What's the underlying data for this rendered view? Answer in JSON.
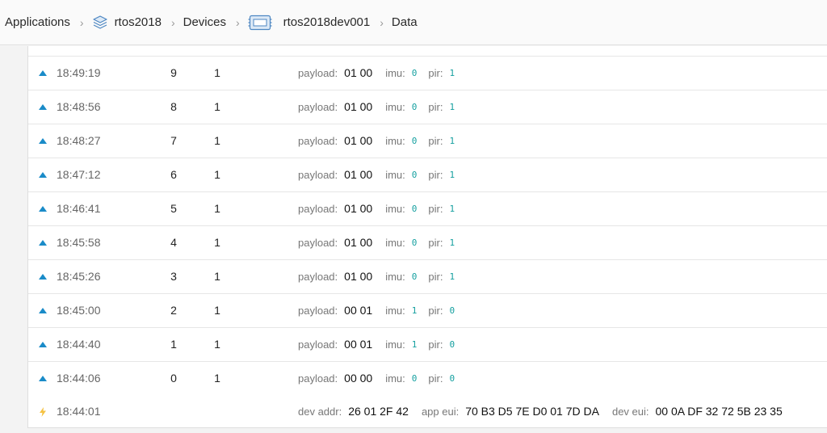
{
  "breadcrumb": {
    "applications": "Applications",
    "app_name": "rtos2018",
    "devices": "Devices",
    "device_name": "rtos2018dev001",
    "data": "Data"
  },
  "colors": {
    "uplink_arrow": "#1a8bc8",
    "activation_bolt": "#f5c242",
    "decoded_value": "#16a0a0"
  },
  "messages": [
    {
      "type": "uplink",
      "time": "18:49:19",
      "counter": "9",
      "port": "1",
      "payload_label": "payload:",
      "payload": "01 00",
      "imu_label": "imu:",
      "imu": "0",
      "pir_label": "pir:",
      "pir": "1"
    },
    {
      "type": "uplink",
      "time": "18:48:56",
      "counter": "8",
      "port": "1",
      "payload_label": "payload:",
      "payload": "01 00",
      "imu_label": "imu:",
      "imu": "0",
      "pir_label": "pir:",
      "pir": "1"
    },
    {
      "type": "uplink",
      "time": "18:48:27",
      "counter": "7",
      "port": "1",
      "payload_label": "payload:",
      "payload": "01 00",
      "imu_label": "imu:",
      "imu": "0",
      "pir_label": "pir:",
      "pir": "1"
    },
    {
      "type": "uplink",
      "time": "18:47:12",
      "counter": "6",
      "port": "1",
      "payload_label": "payload:",
      "payload": "01 00",
      "imu_label": "imu:",
      "imu": "0",
      "pir_label": "pir:",
      "pir": "1"
    },
    {
      "type": "uplink",
      "time": "18:46:41",
      "counter": "5",
      "port": "1",
      "payload_label": "payload:",
      "payload": "01 00",
      "imu_label": "imu:",
      "imu": "0",
      "pir_label": "pir:",
      "pir": "1"
    },
    {
      "type": "uplink",
      "time": "18:45:58",
      "counter": "4",
      "port": "1",
      "payload_label": "payload:",
      "payload": "01 00",
      "imu_label": "imu:",
      "imu": "0",
      "pir_label": "pir:",
      "pir": "1"
    },
    {
      "type": "uplink",
      "time": "18:45:26",
      "counter": "3",
      "port": "1",
      "payload_label": "payload:",
      "payload": "01 00",
      "imu_label": "imu:",
      "imu": "0",
      "pir_label": "pir:",
      "pir": "1"
    },
    {
      "type": "uplink",
      "time": "18:45:00",
      "counter": "2",
      "port": "1",
      "payload_label": "payload:",
      "payload": "00 01",
      "imu_label": "imu:",
      "imu": "1",
      "pir_label": "pir:",
      "pir": "0"
    },
    {
      "type": "uplink",
      "time": "18:44:40",
      "counter": "1",
      "port": "1",
      "payload_label": "payload:",
      "payload": "00 01",
      "imu_label": "imu:",
      "imu": "1",
      "pir_label": "pir:",
      "pir": "0"
    },
    {
      "type": "uplink",
      "time": "18:44:06",
      "counter": "0",
      "port": "1",
      "payload_label": "payload:",
      "payload": "00 00",
      "imu_label": "imu:",
      "imu": "0",
      "pir_label": "pir:",
      "pir": "0"
    }
  ],
  "activation": {
    "time": "18:44:01",
    "dev_addr_label": "dev addr:",
    "dev_addr": "26 01 2F 42",
    "app_eui_label": "app eui:",
    "app_eui": "70 B3 D5 7E D0 01 7D DA",
    "dev_eui_label": "dev eui:",
    "dev_eui": "00 0A DF 32 72 5B 23 35"
  }
}
